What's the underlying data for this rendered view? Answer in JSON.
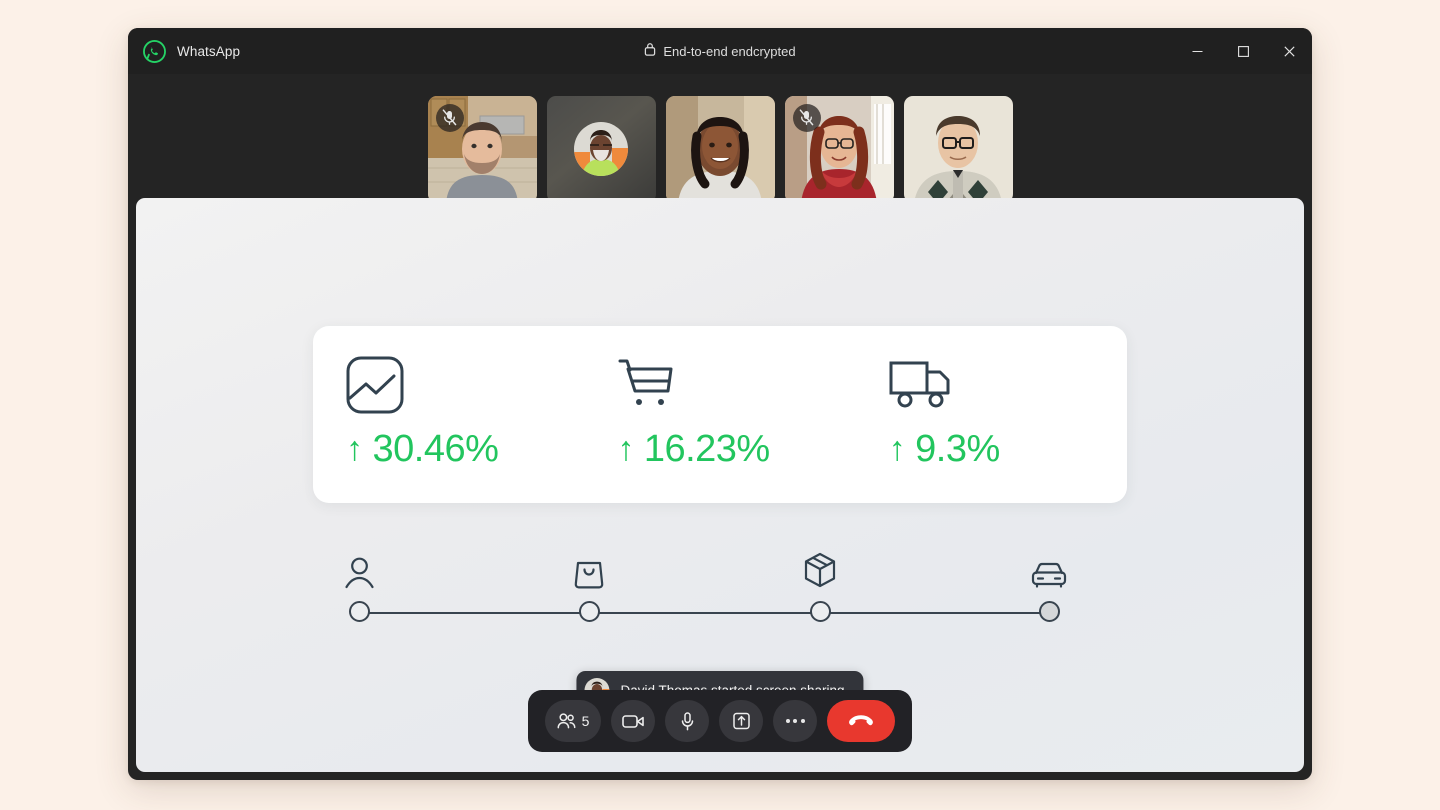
{
  "window": {
    "brand_name": "WhatsApp",
    "encryption_label": "End-to-end endcrypted",
    "encryption_icon": "lock-icon",
    "controls": {
      "minimize": "minimize-icon",
      "maximize": "maximize-icon",
      "close": "close-icon"
    }
  },
  "participants": [
    {
      "name": "participant-1",
      "camera_on": true,
      "muted": true,
      "mute_icon": "mic-off-icon"
    },
    {
      "name": "participant-2",
      "camera_on": false,
      "muted": false,
      "mute_icon": ""
    },
    {
      "name": "participant-3",
      "camera_on": true,
      "muted": false,
      "mute_icon": ""
    },
    {
      "name": "participant-4",
      "camera_on": true,
      "muted": true,
      "mute_icon": "mic-off-icon"
    },
    {
      "name": "participant-5",
      "camera_on": true,
      "muted": false,
      "mute_icon": ""
    }
  ],
  "shared_screen": {
    "metrics": [
      {
        "icon": "image-chart-icon",
        "arrow": "↑",
        "value": "30.46%"
      },
      {
        "icon": "shopping-cart-icon",
        "arrow": "↑",
        "value": "16.23%"
      },
      {
        "icon": "delivery-truck-icon",
        "arrow": "↑",
        "value": "9.3%"
      }
    ],
    "timeline": {
      "steps": [
        {
          "icon": "person-icon",
          "position_pct": 0,
          "filled": false
        },
        {
          "icon": "shopping-bag-icon",
          "position_pct": 33,
          "filled": false
        },
        {
          "icon": "package-box-icon",
          "position_pct": 66.5,
          "filled": false
        },
        {
          "icon": "car-icon",
          "position_pct": 100,
          "filled": true
        }
      ]
    }
  },
  "toast": {
    "avatar": "david-thomas-avatar",
    "message": "David Thomas started screen sharing"
  },
  "call_controls": {
    "participants_label": "5",
    "participants_icon": "people-icon",
    "camera_icon": "video-camera-icon",
    "microphone_icon": "microphone-icon",
    "share_screen_icon": "share-screen-icon",
    "more_icon": "more-options-icon",
    "end_call_icon": "end-call-icon"
  },
  "colors": {
    "page_background": "#fcf1e8",
    "window_chrome": "#202020",
    "accent_green": "#22c55e",
    "brand_green": "#25d366",
    "end_call_red": "#e8382e",
    "ink": "#39444f"
  }
}
